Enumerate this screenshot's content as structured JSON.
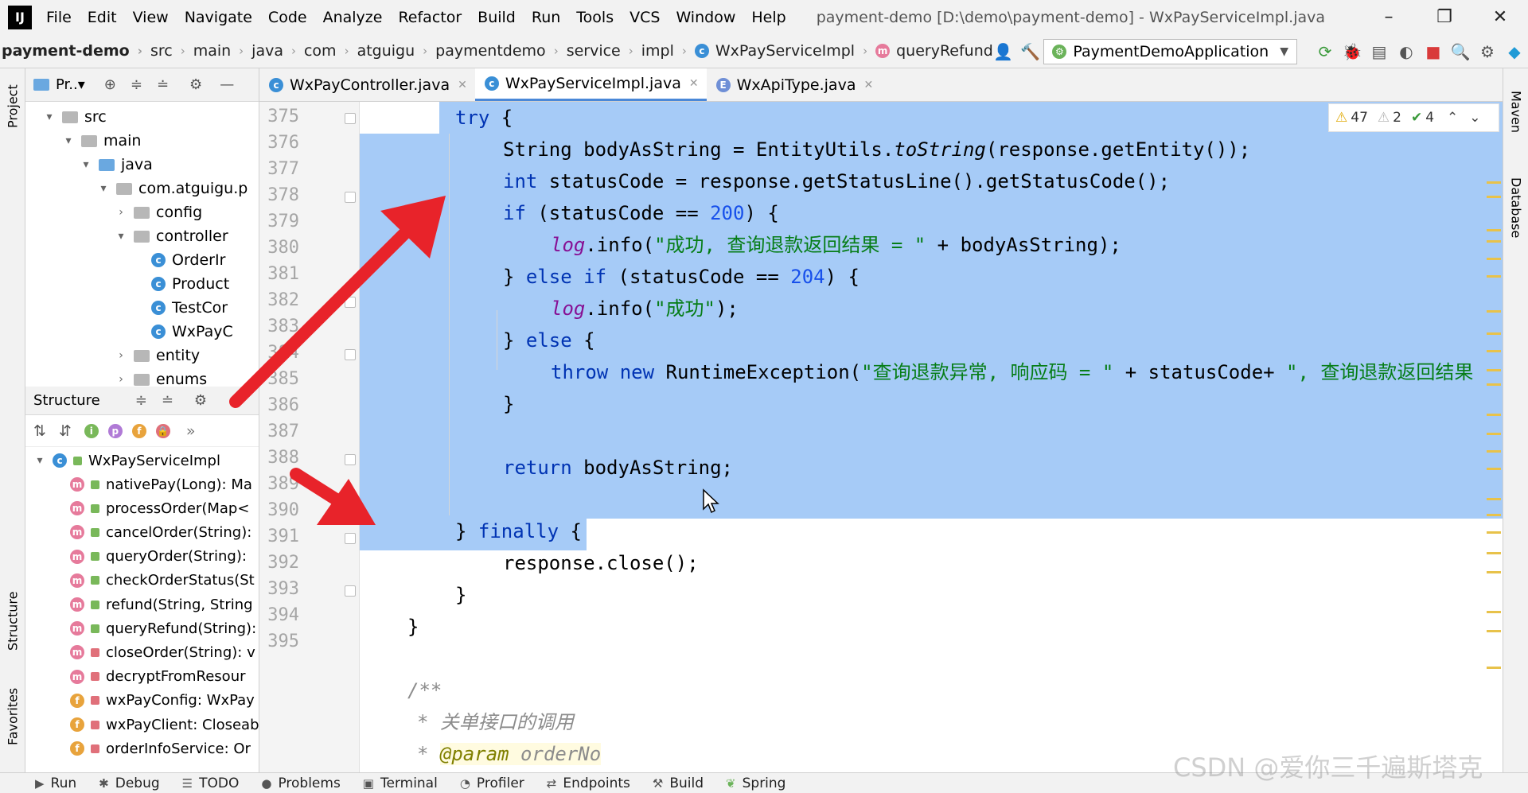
{
  "app": {
    "logo": "IJ",
    "title": "payment-demo [D:\\demo\\payment-demo] - WxPayServiceImpl.java"
  },
  "menu": [
    "File",
    "Edit",
    "View",
    "Navigate",
    "Code",
    "Analyze",
    "Refactor",
    "Build",
    "Run",
    "Tools",
    "VCS",
    "Window",
    "Help"
  ],
  "breadcrumb": [
    "payment-demo",
    "src",
    "main",
    "java",
    "com",
    "atguigu",
    "paymentdemo",
    "service",
    "impl",
    "WxPayServiceImpl",
    "queryRefund"
  ],
  "run_config": "PaymentDemoApplication",
  "left_tabs": {
    "project": "Project",
    "structure": "Structure",
    "favorites": "Favorites"
  },
  "right_tabs": {
    "maven": "Maven",
    "database": "Database"
  },
  "project_panel": {
    "title": "Pr..▾",
    "tree": [
      {
        "label": "src",
        "arrow": "▾"
      },
      {
        "label": "main",
        "arrow": "▾"
      },
      {
        "label": "java",
        "arrow": "▾"
      },
      {
        "label": "com.atguigu.p",
        "arrow": "▾"
      },
      {
        "label": "config",
        "arrow": "›"
      },
      {
        "label": "controller",
        "arrow": "▾"
      },
      {
        "label": "OrderIr",
        "arrow": ""
      },
      {
        "label": "Product",
        "arrow": ""
      },
      {
        "label": "TestCor",
        "arrow": ""
      },
      {
        "label": "WxPayC",
        "arrow": ""
      },
      {
        "label": "entity",
        "arrow": "›"
      },
      {
        "label": "enums",
        "arrow": "›"
      }
    ]
  },
  "structure_panel": {
    "title": "Structure",
    "class_name": "WxPayServiceImpl",
    "members": [
      {
        "kind": "m",
        "access": "pub",
        "label": "nativePay(Long): Ma"
      },
      {
        "kind": "m",
        "access": "pub",
        "label": "processOrder(Map<"
      },
      {
        "kind": "m",
        "access": "pub",
        "label": "cancelOrder(String):"
      },
      {
        "kind": "m",
        "access": "pub",
        "label": "queryOrder(String):"
      },
      {
        "kind": "m",
        "access": "pub",
        "label": "checkOrderStatus(St"
      },
      {
        "kind": "m",
        "access": "pub",
        "label": "refund(String, String"
      },
      {
        "kind": "m",
        "access": "pub",
        "label": "queryRefund(String):"
      },
      {
        "kind": "m",
        "access": "priv",
        "label": "closeOrder(String): v"
      },
      {
        "kind": "m",
        "access": "priv",
        "label": "decryptFromResour"
      },
      {
        "kind": "f",
        "access": "priv",
        "label": "wxPayConfig: WxPay"
      },
      {
        "kind": "f",
        "access": "priv",
        "label": "wxPayClient: Closeab"
      },
      {
        "kind": "f",
        "access": "priv",
        "label": "orderInfoService: Or"
      }
    ]
  },
  "editor_tabs": [
    {
      "label": "WxPayController.java",
      "active": false
    },
    {
      "label": "WxPayServiceImpl.java",
      "active": true
    },
    {
      "label": "WxApiType.java",
      "active": false
    }
  ],
  "line_numbers": [
    "375",
    "376",
    "377",
    "378",
    "379",
    "380",
    "381",
    "382",
    "383",
    "384",
    "385",
    "386",
    "387",
    "388",
    "389",
    "390",
    "391",
    "392",
    "393",
    "394",
    "395"
  ],
  "code": {
    "l375": {
      "kw": "try",
      "rest": " {"
    },
    "l376": {
      "a": "String bodyAsString = EntityUtils.",
      "b": "toString",
      "c": "(response.getEntity());"
    },
    "l377": {
      "kw": "int",
      "rest": " statusCode = response.getStatusLine().getStatusCode();"
    },
    "l378": {
      "kw": "if",
      "a": " (statusCode == ",
      "num": "200",
      "b": ") {"
    },
    "l379": {
      "log": "log",
      "a": ".info(",
      "str": "\"成功, 查询退款返回结果 = \"",
      "b": " + bodyAsString);"
    },
    "l380": {
      "a": "} ",
      "kw": "else if",
      "b": " (statusCode == ",
      "num": "204",
      "c": ") {"
    },
    "l381": {
      "log": "log",
      "a": ".info(",
      "str": "\"成功\"",
      "b": ");"
    },
    "l382": {
      "a": "} ",
      "kw": "else",
      "b": " {"
    },
    "l383": {
      "kw": "throw new",
      "a": " RuntimeException(",
      "str": "\"查询退款异常, 响应码 = \"",
      "b": " + statusCode+ ",
      "str2": "\", 查询退款返回结果"
    },
    "l384": "}",
    "l386": {
      "kw": "return",
      "rest": " bodyAsString;"
    },
    "l388": {
      "a": "} ",
      "kw": "finally",
      "b": " {"
    },
    "l389": "response.close();",
    "l390": "}",
    "l391": "}",
    "l393": "/**",
    "l394": "* 关单接口的调用",
    "l395": {
      "a": "* ",
      "tag": "@param",
      "b": " orderNo"
    }
  },
  "inspections": {
    "warn": "47",
    "weak": "2",
    "ok": "4"
  },
  "status_bar": [
    "Run",
    "Debug",
    "TODO",
    "Problems",
    "Terminal",
    "Profiler",
    "Endpoints",
    "Build",
    "Spring"
  ],
  "watermark": "CSDN @爱你三千遍斯塔克",
  "colors": {
    "selection": "#a6cbf7",
    "keyword": "#0033b3",
    "string": "#067d17",
    "number": "#1750eb",
    "arrow": "#e8232a"
  }
}
